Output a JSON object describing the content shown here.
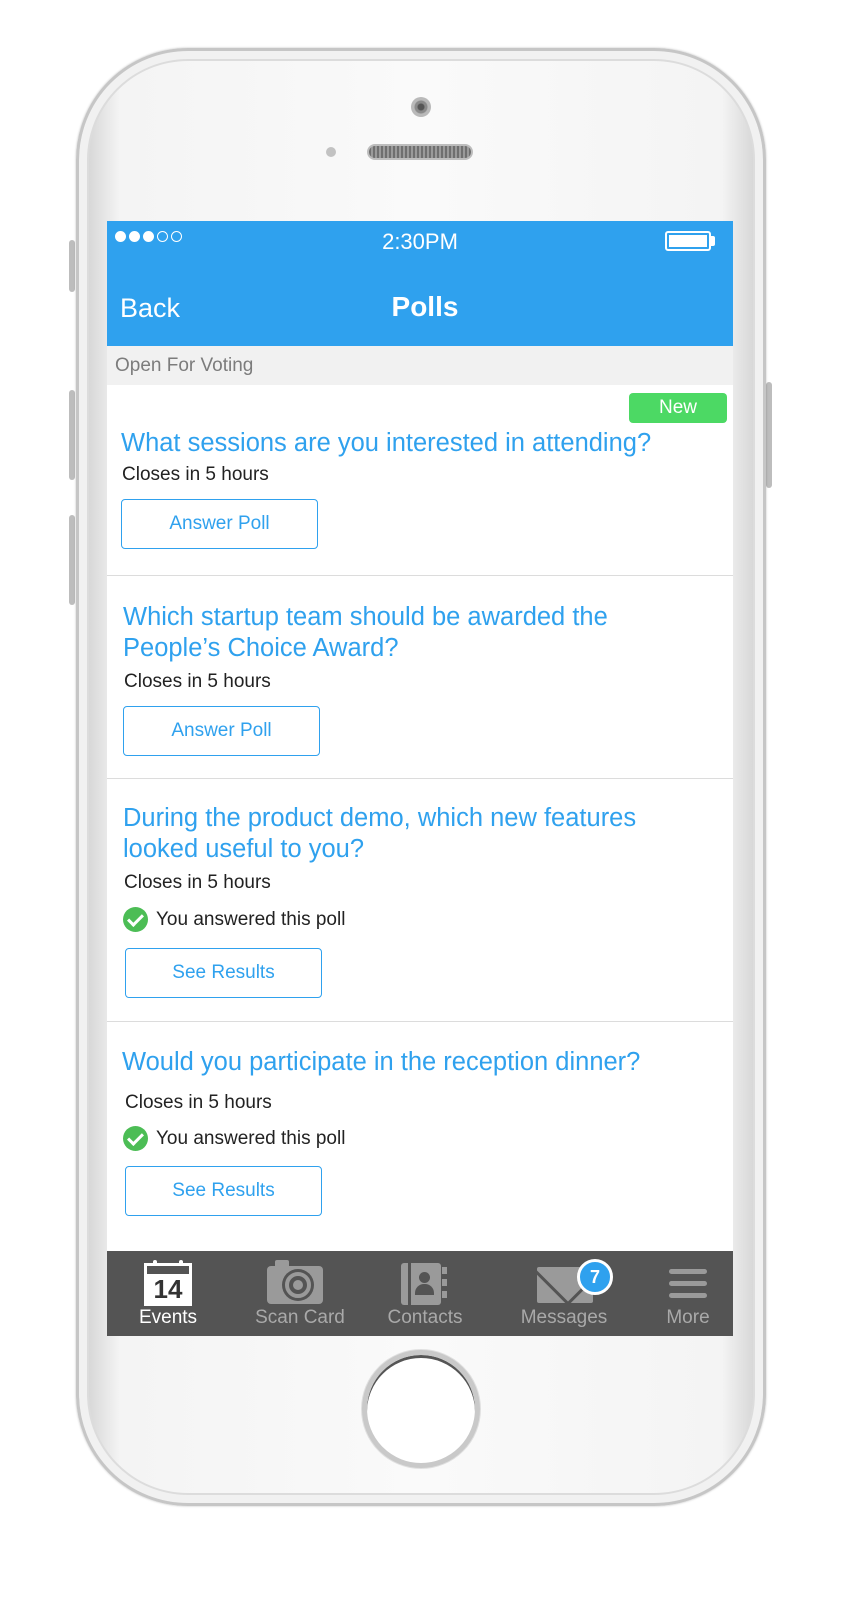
{
  "status_bar": {
    "signal_dots": [
      true,
      true,
      true,
      false,
      false
    ],
    "time": "2:30PM",
    "battery_level": 1.0
  },
  "nav": {
    "back_label": "Back",
    "title": "Polls"
  },
  "section": {
    "title": "Open For Voting"
  },
  "polls": [
    {
      "badge": "New",
      "question": "What sessions are you interested in attending?",
      "closes": "Closes in 5 hours",
      "answered_text": "",
      "button_label": "Answer Poll"
    },
    {
      "badge": "",
      "question": "Which startup team should be awarded the People’s Choice Award?",
      "closes": "Closes in 5 hours",
      "answered_text": "",
      "button_label": "Answer Poll"
    },
    {
      "badge": "",
      "question": "During the product demo, which new features looked useful to you?",
      "closes": "Closes in 5 hours",
      "answered_text": "You answered this poll",
      "button_label": "See Results"
    },
    {
      "badge": "",
      "question": "Would you participate in the reception dinner?",
      "closes": "Closes in 5 hours",
      "answered_text": "You answered this poll",
      "button_label": "See Results"
    }
  ],
  "tabbar": {
    "events": {
      "label": "Events",
      "icon": "calendar-icon",
      "date": "14"
    },
    "scan_card": {
      "label": "Scan Card",
      "icon": "camera-icon"
    },
    "contacts": {
      "label": "Contacts",
      "icon": "contacts-book-icon"
    },
    "messages": {
      "label": "Messages",
      "icon": "envelope-icon",
      "badge": "7"
    },
    "more": {
      "label": "More",
      "icon": "hamburger-icon"
    }
  },
  "colors": {
    "accent": "#2fa1ee",
    "new_badge": "#4cd964",
    "check": "#4cbd55",
    "tabbar": "#545454"
  }
}
